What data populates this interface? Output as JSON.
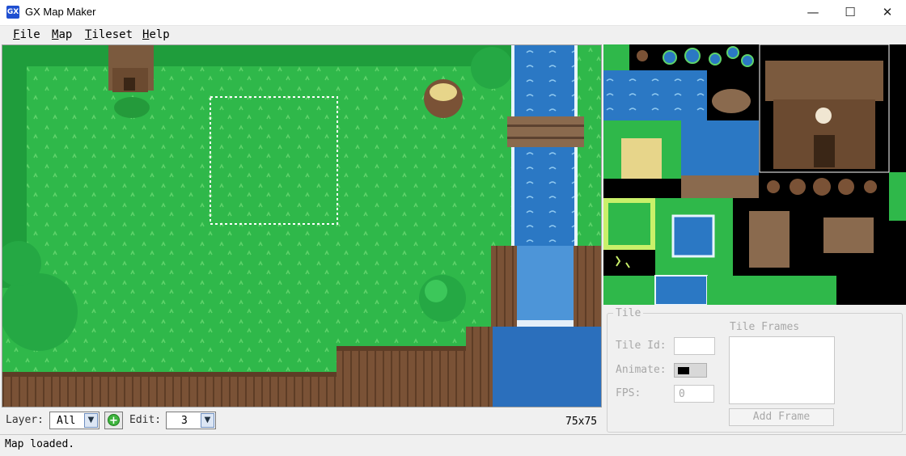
{
  "window": {
    "title": "GX Map Maker",
    "icon_text": "GX"
  },
  "menu": [
    {
      "key": "F",
      "rest": "ile"
    },
    {
      "key": "M",
      "rest": "ap"
    },
    {
      "key": "T",
      "rest": "ileset"
    },
    {
      "key": "H",
      "rest": "elp"
    }
  ],
  "toolbar": {
    "layer_label": "Layer:",
    "layer_value": "All",
    "edit_label": "Edit:",
    "edit_value": "3",
    "map_size": "75x75"
  },
  "tile_panel": {
    "group_title": "Tile",
    "tile_id_label": "Tile Id:",
    "tile_id_value": "",
    "animate_label": "Animate:",
    "fps_label": "FPS:",
    "fps_value": "0",
    "frames_label": "Tile Frames",
    "add_frame_label": "Add Frame"
  },
  "status": {
    "text": "Map loaded."
  },
  "colors": {
    "grass": "#2fb84a",
    "grass_dark": "#249a3b",
    "water": "#2b78c4",
    "dirt": "#7a5236",
    "wood": "#8a6a4e"
  }
}
